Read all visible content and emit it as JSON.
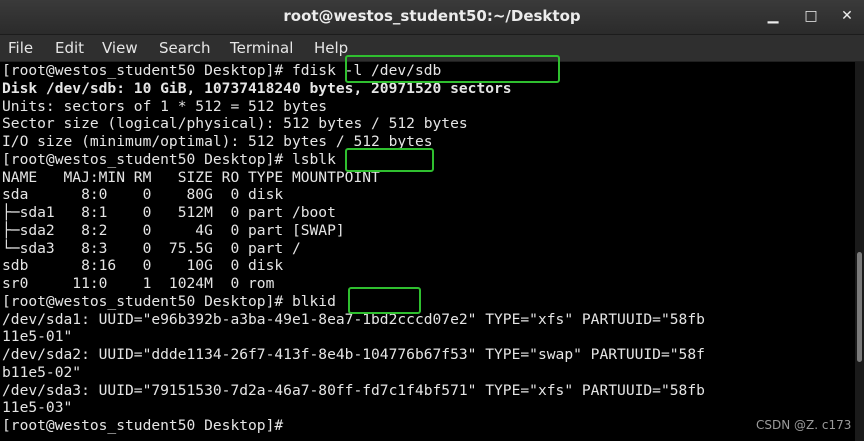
{
  "window": {
    "title": "root@westos_student50:~/Desktop",
    "minimize_glyph": "▁",
    "maximize_glyph": "□",
    "close_glyph": "✕"
  },
  "menu": {
    "items": [
      "File",
      "Edit",
      "View",
      "Search",
      "Terminal",
      "Help"
    ]
  },
  "terminal": {
    "lines": [
      {
        "text": "[root@westos_student50 Desktop]# fdisk -l /dev/sdb",
        "bold": false
      },
      {
        "text": "Disk /dev/sdb: 10 GiB, 10737418240 bytes, 20971520 sectors",
        "bold": true
      },
      {
        "text": "Units: sectors of 1 * 512 = 512 bytes",
        "bold": false
      },
      {
        "text": "Sector size (logical/physical): 512 bytes / 512 bytes",
        "bold": false
      },
      {
        "text": "I/O size (minimum/optimal): 512 bytes / 512 bytes",
        "bold": false
      },
      {
        "text": "[root@westos_student50 Desktop]# lsblk",
        "bold": false
      },
      {
        "text": "NAME   MAJ:MIN RM   SIZE RO TYPE MOUNTPOINT",
        "bold": false
      },
      {
        "text": "sda      8:0    0    80G  0 disk",
        "bold": false
      },
      {
        "text": "├─sda1   8:1    0   512M  0 part /boot",
        "bold": false
      },
      {
        "text": "├─sda2   8:2    0     4G  0 part [SWAP]",
        "bold": false
      },
      {
        "text": "└─sda3   8:3    0  75.5G  0 part /",
        "bold": false
      },
      {
        "text": "sdb      8:16   0    10G  0 disk",
        "bold": false
      },
      {
        "text": "sr0     11:0    1  1024M  0 rom",
        "bold": false
      },
      {
        "text": "[root@westos_student50 Desktop]# blkid",
        "bold": false
      },
      {
        "text": "/dev/sda1: UUID=\"e96b392b-a3ba-49e1-8ea7-1bd2cccd07e2\" TYPE=\"xfs\" PARTUUID=\"58fb",
        "bold": false
      },
      {
        "text": "11e5-01\"",
        "bold": false
      },
      {
        "text": "/dev/sda2: UUID=\"ddde1134-26f7-413f-8e4b-104776b67f53\" TYPE=\"swap\" PARTUUID=\"58f",
        "bold": false
      },
      {
        "text": "b11e5-02\"",
        "bold": false
      },
      {
        "text": "/dev/sda3: UUID=\"79151530-7d2a-46a7-80ff-fd7c1f4bf571\" TYPE=\"xfs\" PARTUUID=\"58fb",
        "bold": false
      },
      {
        "text": "11e5-03\"",
        "bold": false
      },
      {
        "text": "[root@westos_student50 Desktop]#",
        "bold": false
      }
    ]
  },
  "highlights": {
    "color": "#2fbf2f",
    "commands": [
      "fdisk -l /dev/sdb",
      "lsblk",
      "blkid"
    ]
  },
  "watermark": "CSDN @Z. c173"
}
